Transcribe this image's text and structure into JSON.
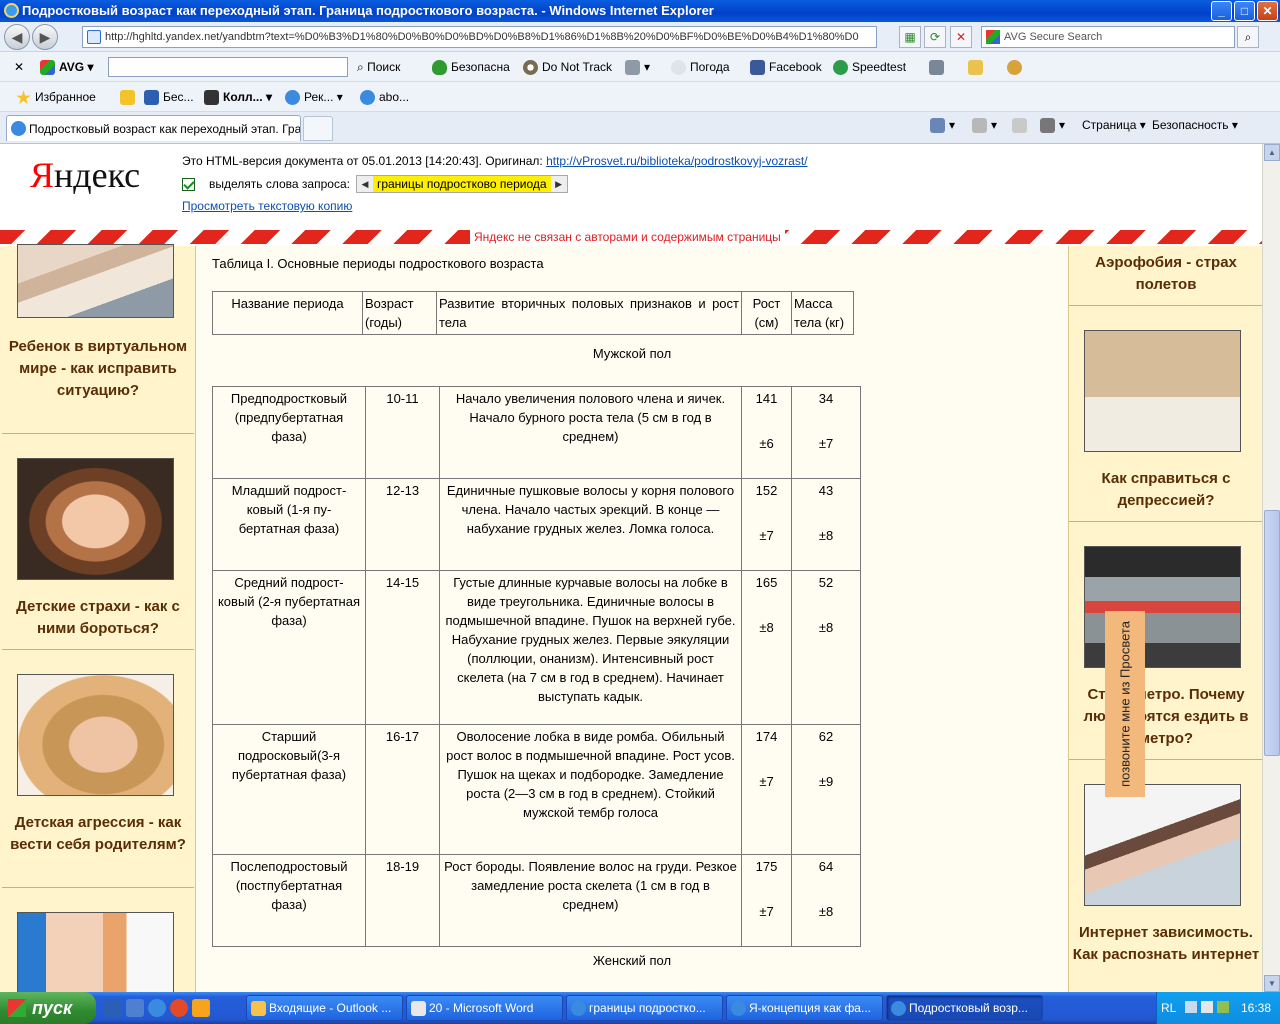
{
  "window": {
    "title": "Подростковый возраст как переходный этап. Граница подросткового возраста. - Windows Internet Explorer",
    "minimize": "_",
    "maximize": "□",
    "close": "✕"
  },
  "address": {
    "url": "http://hghltd.yandex.net/yandbtm?text=%D0%B3%D1%80%D0%B0%D0%BD%D0%B8%D1%86%D1%8B%20%D0%BF%D0%BE%D0%B4%D1%80%D0",
    "search_placeholder": "AVG Secure Search"
  },
  "avg_toolbar": {
    "close": "✕",
    "brand": "AVG",
    "search_btn": "Поиск",
    "safe": "Безопасна",
    "dnt": "Do Not Track",
    "weather": "Погода",
    "facebook": "Facebook",
    "speedtest": "Speedtest"
  },
  "favorites": {
    "label": "Избранное",
    "items": [
      "Бес...",
      "Колл...",
      "Рек...",
      "abo..."
    ]
  },
  "tab": {
    "title": "Подростковый возраст как переходный этап. Гра..."
  },
  "commands": {
    "page": "Страница",
    "safety": "Безопасность"
  },
  "yandex": {
    "logo_y": "Я",
    "logo_rest": "ндекс",
    "info": "Это HTML-версия документа от 05.01.2013 [14:20:43]. Оригинал: ",
    "original_url": "http://vProsvet.ru/biblioteka/podrostkovyj-vozrast/",
    "highlight_label": "выделять слова запроса:",
    "query": "границы подростково периода",
    "text_copy": "Просмотреть текстовую копию",
    "disclaimer": "Яндекс не связан с авторами и содержимым страницы"
  },
  "left_cards": [
    {
      "title": "Ребенок в виртуальном мире - как исправить ситуацию?",
      "image": "children-laptop-photo"
    },
    {
      "title": "Детские страхи - как с ними бороться?",
      "image": "scared-girl-photo"
    },
    {
      "title": "Детская агрессия - как вести себя родителям?",
      "image": "angry-girl-photo"
    },
    {
      "title": "",
      "image": "peeking-girl-photo"
    }
  ],
  "right_cards": [
    {
      "title": "Аэрофобия - страх полетов",
      "image": ""
    },
    {
      "title": "Как справиться с депрессией?",
      "image": "sad-woman-bed-photo"
    },
    {
      "title": "Страх метро. Почему люди боятся ездить в метро?",
      "image": "metro-train-photo"
    },
    {
      "title": "Интернет зависимость. Как распознать интернет",
      "image": "woman-laptop-photo"
    }
  ],
  "call_button": "позвоните мне из Просвета",
  "article": {
    "table_title": "Таблица I. Основные периоды подросткового возраста",
    "headers": [
      "Название периода",
      "Возраст (годы)",
      "Развитие вторичных половых признаков и рост тела",
      "Рост (см)",
      "Масса тела (кг)"
    ],
    "male_label": "Мужской пол",
    "female_label": "Женский пол",
    "rows": [
      {
        "name": "Предподростковый (предпубертатная фаза)",
        "age": "10-11",
        "desc": "Начало увеличения полового члена и яичек. Начало бурного роста тела (5 см в год в среднем)",
        "height": "141",
        "height_dev": "±6",
        "mass": "34",
        "mass_dev": "±7"
      },
      {
        "name": "Младший подрост-ковый (1-я пу-бертатная фаза)",
        "age": "12-13",
        "desc": "Единичные пушковые волосы у корня полового члена. Начало частых эрекций. В конце — набухание грудных желез. Ломка голоса.",
        "height": "152",
        "height_dev": "±7",
        "mass": "43",
        "mass_dev": "±8"
      },
      {
        "name": "Средний подрост-ковый (2-я пубертатная фаза)",
        "age": "14-15",
        "desc": "Густые длинные курчавые волосы на лобке в виде треугольника. Единичные волосы в подмышечной впадине. Пушок на верхней губе. Набухание грудных желез. Первые эякуляции (поллюции, онанизм). Интенсивный рост скелета (на 7 см в год в среднем). Начинает выступать кадык.",
        "height": "165",
        "height_dev": "±8",
        "mass": "52",
        "mass_dev": "±8"
      },
      {
        "name": "Старший подросковый(3-я пубертатная фаза)",
        "age": "16-17",
        "desc": "Оволосение лобка в виде ромба. Обильный рост волос в подмышечной впадине. Рост усов. Пушок на щеках и подбородке. Замедление роста (2—3 см в год в среднем). Стойкий мужской тембр голоса",
        "height": "174",
        "height_dev": "±7",
        "mass": "62",
        "mass_dev": "±9"
      },
      {
        "name": "Послеподростовый (постпубертатная фаза)",
        "age": "18-19",
        "desc": "Рост бороды. Появление волос на груди. Резкое замедление роста скелета (1 см в год в среднем)",
        "height": "175",
        "height_dev": "±7",
        "mass": "64",
        "mass_dev": "±8"
      }
    ]
  },
  "taskbar": {
    "start": "пуск",
    "tasks": [
      "Входящие - Outlook ...",
      "20 - Microsoft Word",
      "границы подростко...",
      "Я-концепция как фа...",
      "Подростковый возр..."
    ],
    "lang": "RL",
    "clock": "16:38"
  }
}
